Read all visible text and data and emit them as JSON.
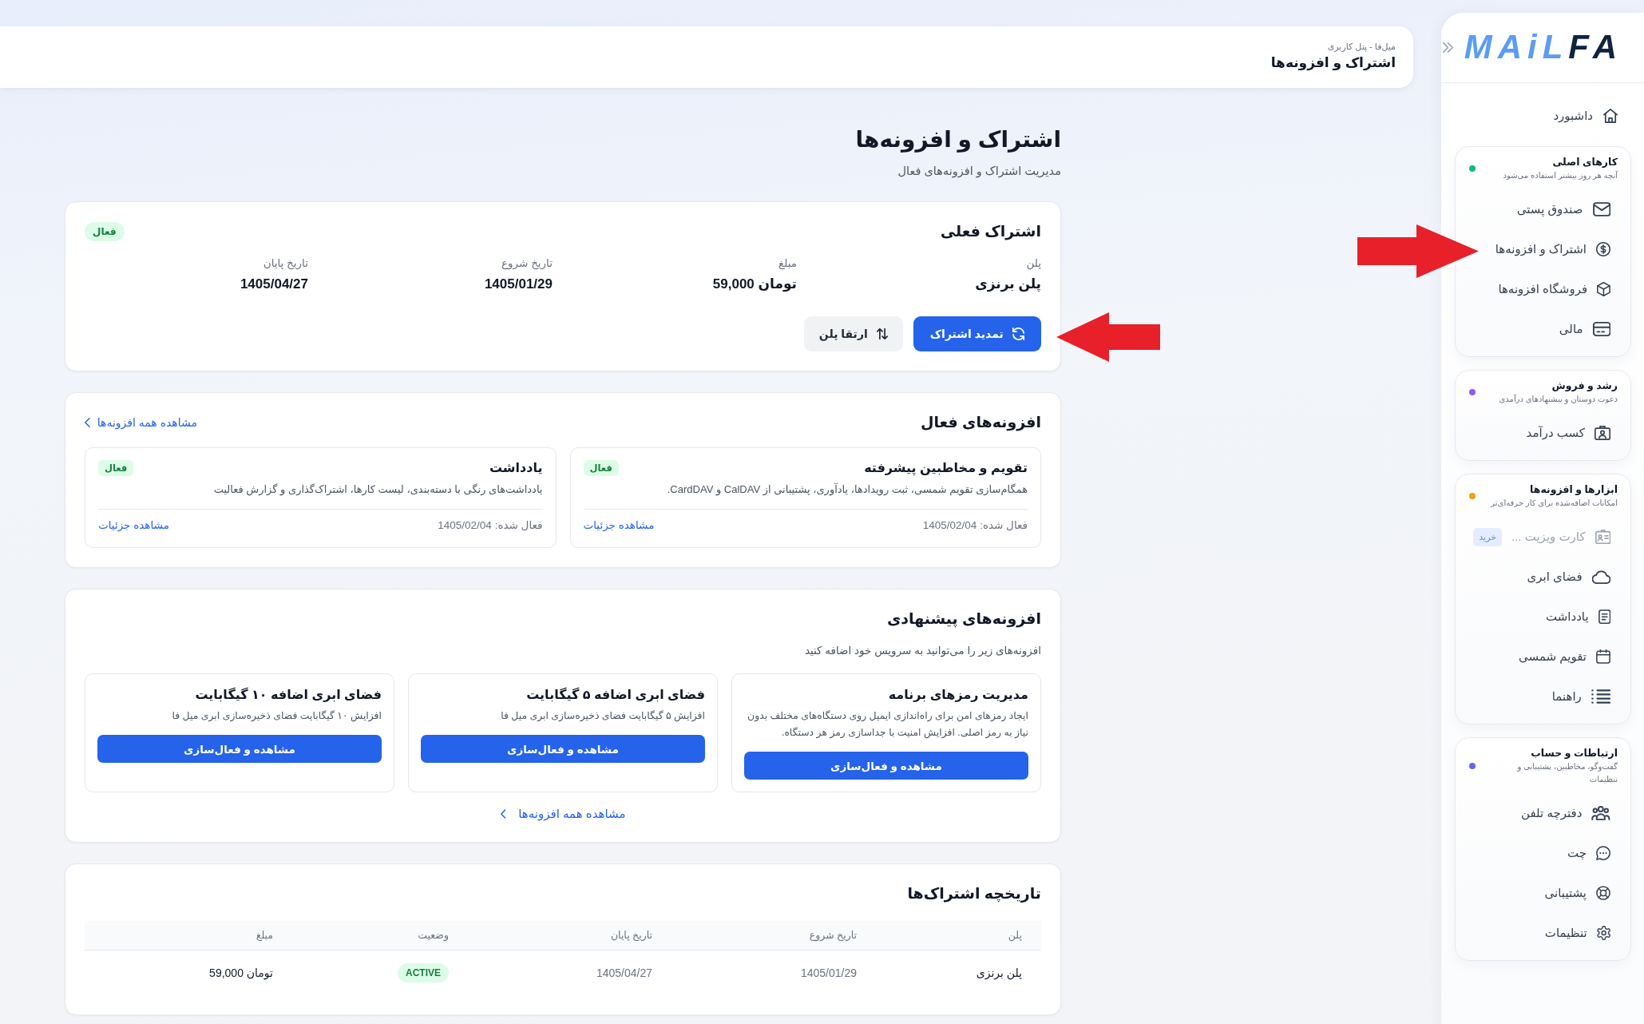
{
  "sidebar": {
    "logo": {
      "text": "MAiL",
      "accent": "FA"
    },
    "dashboard": {
      "label": "داشبورد"
    },
    "groups": [
      {
        "title": "کارهای اصلی",
        "subtitle": "آنچه هر روز بیشتر استفاده می‌شود",
        "color": "#10b981",
        "items": [
          {
            "label": "صندوق پستی",
            "disabled": false
          },
          {
            "label": "اشتراک و افزونه‌ها",
            "disabled": false
          },
          {
            "label": "فروشگاه افزونه‌ها",
            "disabled": false
          },
          {
            "label": "مالی",
            "disabled": false
          }
        ]
      },
      {
        "title": "رشد و فروش",
        "subtitle": "دعوت دوستان و پیشنهادهای درآمدی",
        "color": "#8b5cf6",
        "items": [
          {
            "label": "کسب درآمد",
            "disabled": false
          }
        ]
      },
      {
        "title": "ابزارها و افزونه‌ها",
        "subtitle": "امکانات اضافه‌شده برای کار حرفه‌ای‌تر",
        "color": "#f59e0b",
        "items": [
          {
            "label": "کارت ویزیت ...",
            "disabled": true,
            "badge": "خرید"
          },
          {
            "label": "فضای ابری",
            "disabled": false
          },
          {
            "label": "یادداشت",
            "disabled": false
          },
          {
            "label": "تقویم شمسی",
            "disabled": false
          },
          {
            "label": "راهنما",
            "disabled": false
          }
        ]
      },
      {
        "title": "ارتباطات و حساب",
        "subtitle": "گفت‌وگو، مخاطبین، پشتیبانی و تنظیمات",
        "color": "#6366f1",
        "items": [
          {
            "label": "دفترچه تلفن",
            "disabled": false
          },
          {
            "label": "چت",
            "disabled": false
          },
          {
            "label": "پشتیبانی",
            "disabled": false
          },
          {
            "label": "تنظیمات",
            "disabled": false
          }
        ]
      }
    ]
  },
  "header": {
    "breadcrumb": "میل‌فا - پنل کاربری",
    "title": "اشتراک و افزونه‌ها"
  },
  "page": {
    "title": "اشتراک و افزونه‌ها",
    "subtitle": "مدیریت اشتراک و افزونه‌های فعال"
  },
  "current_subscription": {
    "title": "اشتراک فعلی",
    "badge": "فعال",
    "fields": [
      {
        "label": "پلن",
        "value": "پلن برنزی"
      },
      {
        "label": "مبلغ",
        "value": "59,000 تومان"
      },
      {
        "label": "تاریخ شروع",
        "value": "1405/01/29"
      },
      {
        "label": "تاریخ پایان",
        "value": "1405/04/27"
      }
    ],
    "buttons": [
      {
        "kind": "primary",
        "label": "تمدید اشتراک"
      },
      {
        "kind": "secondary",
        "label": "ارتقا پلن"
      }
    ]
  },
  "active_addons": {
    "title": "افزونه‌های فعال",
    "view_all": "مشاهده همه افزونه‌ها",
    "items": [
      {
        "title": "تقویم و مخاطبین پیشرفته",
        "badge": "فعال",
        "description": "همگام‌سازی تقویم شمسی، ثبت رویدادها، یادآوری، پشتیبانی از CalDAV و CardDAV.",
        "activated": "فعال شده: 1405/02/04",
        "link": "مشاهده جزئیات"
      },
      {
        "title": "یادداشت",
        "badge": "فعال",
        "description": "یادداشت‌های رنگی با دسته‌بندی، لیست کارها، اشتراک‌گذاری و گزارش فعالیت",
        "activated": "فعال شده: 1405/02/04",
        "link": "مشاهده جزئیات"
      }
    ]
  },
  "suggested_addons": {
    "title": "افزونه‌های پیشنهادی",
    "description": "افزونه‌های زیر را می‌توانید به سرویس خود اضافه کنید",
    "items": [
      {
        "title": "مدیریت رمزهای برنامه",
        "description": "ایجاد رمزهای امن برای راه‌اندازی ایمیل روی دستگاه‌های مختلف بدون نیاز به رمز اصلی. افزایش امنیت با جداسازی رمز هر دستگاه.",
        "button": "مشاهده و فعال‌سازی"
      },
      {
        "title": "فضای ابری اضافه ۵ گیگابایت",
        "description": "افزایش ۵ گیگابایت فضای ذخیره‌سازی ابری میل فا",
        "button": "مشاهده و فعال‌سازی"
      },
      {
        "title": "فضای ابری اضافه ۱۰ گیگابایت",
        "description": "افزایش ۱۰ گیگابایت فضای ذخیره‌سازی ابری میل فا",
        "button": "مشاهده و فعال‌سازی"
      }
    ],
    "view_all": "مشاهده همه افزونه‌ها"
  },
  "subscription_history": {
    "title": "تاریخچه اشتراک‌ها",
    "columns": [
      "پلن",
      "تاریخ شروع",
      "تاریخ پایان",
      "وضعیت",
      "مبلغ"
    ],
    "rows": [
      [
        {
          "kind": "strong",
          "text": "پلن برنزی"
        },
        {
          "kind": "muted",
          "text": "1405/01/29"
        },
        {
          "kind": "muted",
          "text": "1405/04/27"
        },
        {
          "kind": "badge",
          "text": "ACTIVE"
        },
        {
          "kind": "strong",
          "text": "59,000 تومان"
        }
      ]
    ]
  },
  "annotations": [
    {
      "kind": "arrow",
      "pointing_right": false
    },
    {
      "kind": "arrow",
      "pointing_right": true
    }
  ]
}
